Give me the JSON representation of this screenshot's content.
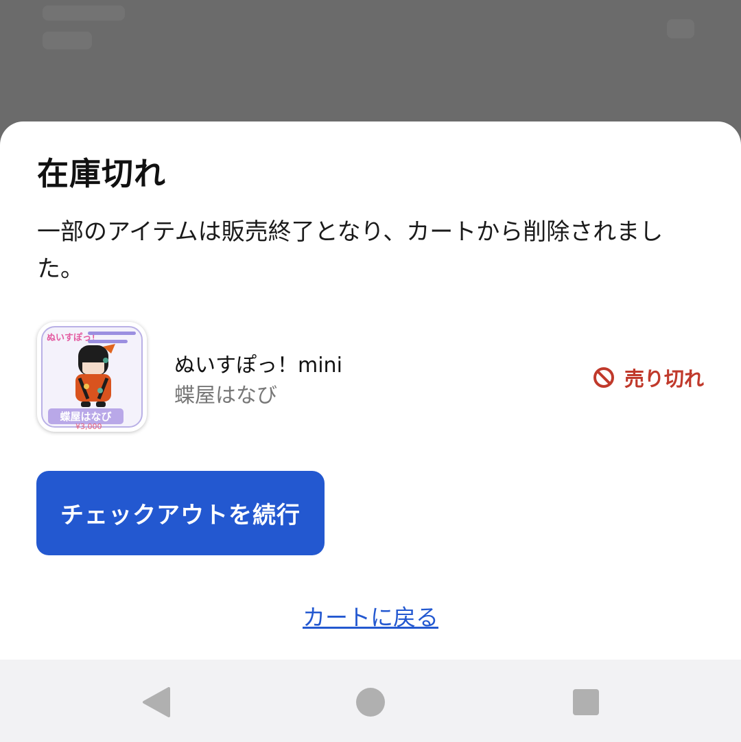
{
  "dialog": {
    "title": "在庫切れ",
    "message": "一部のアイテムは販売終了となり、カートから削除されました。"
  },
  "item": {
    "name": "ぬいすぽっ！mini",
    "subtitle": "蝶屋はなび",
    "status_label": "売り切れ",
    "status_icon": "no-entry-icon",
    "status_color": "#c0392b",
    "thumbnail": {
      "logo_text": "ぬいすぽっ！",
      "name_text": "蝶屋はなび",
      "price_text": "¥3,000"
    }
  },
  "actions": {
    "checkout_label": "チェックアウトを続行",
    "back_label": "カートに戻る",
    "accent_color": "#2358d0"
  },
  "navigation_bar": {
    "buttons": [
      "back-icon",
      "home-icon",
      "recents-icon"
    ]
  }
}
